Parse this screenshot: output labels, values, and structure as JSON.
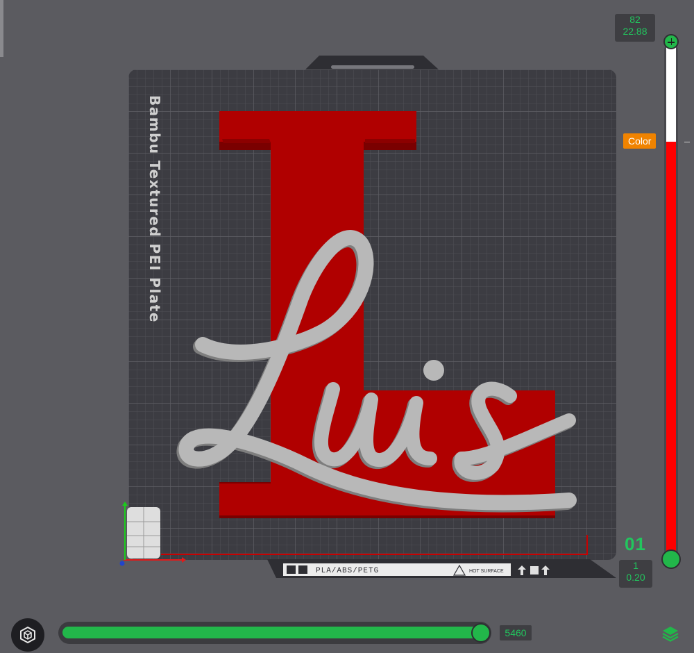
{
  "plate": {
    "name": "Bambu Textured PEI Plate",
    "filament_label": "PLA/ABS/PETG",
    "hot_surface_label": "HOT SURFACE"
  },
  "model": {
    "letter": "L",
    "text": "Luis",
    "letter_color": "#b00000",
    "text_color": "#b8b8b8"
  },
  "layer_slider": {
    "top_layer": "82",
    "top_height": "22.88",
    "bottom_layer": "1",
    "bottom_height": "0.20",
    "current_layer_big": "01",
    "color_button_label": "Color",
    "colors": {
      "upper": "#ffffff",
      "lower": "#ff0000",
      "handle": "#22b74a"
    },
    "color_change_fraction": 0.24
  },
  "move_slider": {
    "value": "5460",
    "fill_fraction": 1.0
  },
  "icons": {
    "view_cube": "cube-view-icon",
    "layers": "layers-icon",
    "plate_logo": "bambu-logo-icon"
  }
}
